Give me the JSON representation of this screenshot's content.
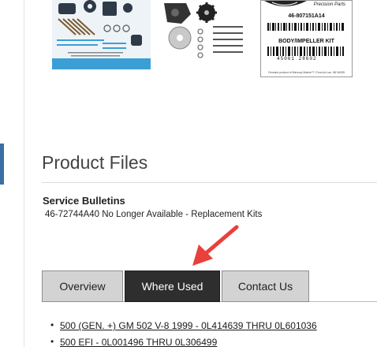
{
  "images": {
    "kit_photo_1": {
      "alt": "water pump kit components"
    },
    "kit_photo_2": {
      "alt": "impeller kit parts"
    },
    "package_label": {
      "brand": "Precision Parts",
      "part_number": "46-807151A14",
      "kit_name": "BODY/IMPELLER KIT",
      "barcode_number": "45061 28602",
      "fine_print": "Genuine product of Mercury Marine™, Fond du Lac, WI 54935"
    }
  },
  "product_files": {
    "title": "Product Files",
    "bulletins_heading": "Service Bulletins",
    "bulletins": [
      "46-72744A40 No Longer Available - Replacement Kits"
    ]
  },
  "tabs": {
    "overview": "Overview",
    "where_used": "Where Used",
    "contact": "Contact Us",
    "active": "where_used"
  },
  "where_used": [
    "500 (GEN. +) GM 502 V-8 1999 - 0L414639 THRU 0L601036",
    "500 EFI - 0L001496 THRU 0L306499"
  ],
  "colors": {
    "active_tab": "#2e2e2e",
    "inactive_tab": "#d3d3d3",
    "annotation_arrow": "#e8403b",
    "accent_bar": "#3a6ea5"
  }
}
